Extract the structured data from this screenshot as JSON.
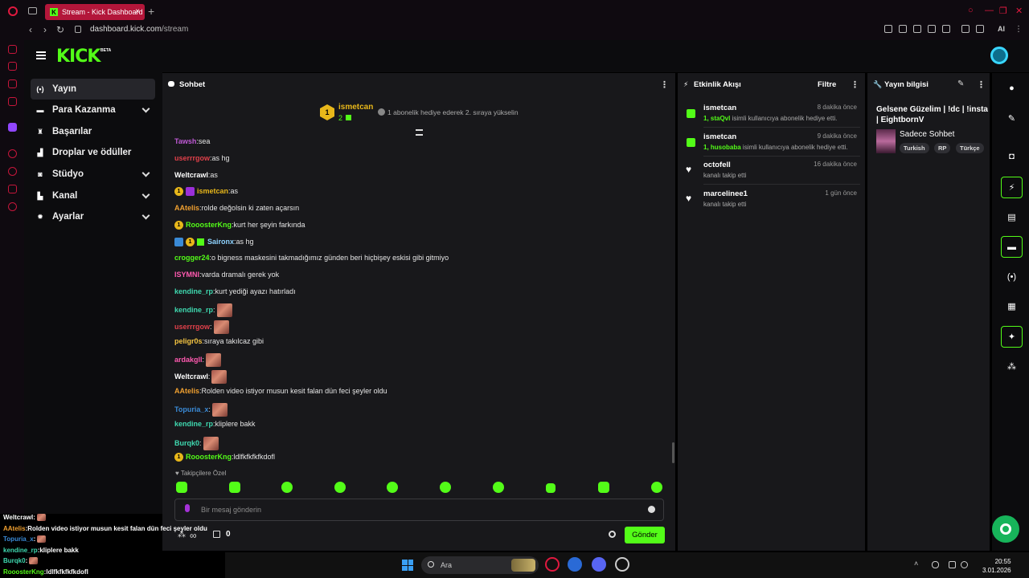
{
  "browser": {
    "tab_title": "Stream - Kick Dashboard",
    "url_host": "dashboard.kick.com",
    "url_path": "/stream",
    "ai_label": "AI"
  },
  "header": {
    "logo": "KICK",
    "beta": "BETA"
  },
  "nav": {
    "items": [
      {
        "label": "Yayın",
        "icon": "broadcast-icon",
        "active": true,
        "expandable": false
      },
      {
        "label": "Para Kazanma",
        "icon": "money-icon",
        "expandable": true
      },
      {
        "label": "Başarılar",
        "icon": "trophy-icon",
        "expandable": false
      },
      {
        "label": "Droplar ve ödüller",
        "icon": "drops-icon",
        "expandable": false
      },
      {
        "label": "Stüdyo",
        "icon": "studio-icon",
        "expandable": true
      },
      {
        "label": "Kanal",
        "icon": "channel-icon",
        "expandable": true
      },
      {
        "label": "Ayarlar",
        "icon": "gear-icon",
        "expandable": true
      }
    ]
  },
  "chat": {
    "title": "Sohbet",
    "pinned": {
      "user": "ismetcan",
      "badge": "1",
      "count": "2",
      "message": "1 abonelik hediye ederek 2. sıraya yükselin"
    },
    "messages": [
      {
        "user": "Tawsh",
        "color": "#c05ad6",
        "text": "sea"
      },
      {
        "user": "userrrgow",
        "color": "#e0404a",
        "text": "as hg"
      },
      {
        "user": "Weltcrawl",
        "color": "#ffffff",
        "text": "as"
      },
      {
        "user": "ismetcan",
        "color": "#e8b71a",
        "text": "as",
        "badges": [
          "sub",
          "purple"
        ]
      },
      {
        "user": "AAtelis",
        "color": "#f0a030",
        "text": "rolde değolsin ki zaten açarsın"
      },
      {
        "user": "RooosterKng",
        "color": "#53fc18",
        "text": "kurt her şeyin farkında",
        "badges": [
          "sub"
        ]
      },
      {
        "user": "Saironx",
        "color": "#8fd3ff",
        "text": "as hg",
        "badges": [
          "blue",
          "sub",
          "gift"
        ]
      },
      {
        "user": "crogger24",
        "color": "#53fc18",
        "text": "o bigness maskesini takmadığımız günden beri hiçbişey eskisi gibi gitmiyo"
      },
      {
        "user": "ISYMNI",
        "color": "#ff5ab0",
        "text": "varda dramalı gerek yok"
      },
      {
        "user": "kendine_rp",
        "color": "#3fd9b0",
        "text": "kurt yediği ayazı hatırladı"
      },
      {
        "user": "kendine_rp",
        "color": "#3fd9b0",
        "text": "",
        "emote": true
      },
      {
        "user": "userrrgow",
        "color": "#e0404a",
        "text": "",
        "emote": true
      },
      {
        "user": "peligr0s",
        "color": "#f5c542",
        "text": "sıraya takılcaz gibi"
      },
      {
        "user": "ardakgll",
        "color": "#ff5ab0",
        "text": "",
        "emote": true
      },
      {
        "user": "Weltcrawl",
        "color": "#ffffff",
        "text": "",
        "emote": true
      },
      {
        "user": "AAtelis",
        "color": "#f0a030",
        "text": "Rolden video istiyor musun kesit falan dün feci şeyler oldu"
      },
      {
        "user": "Topuria_x",
        "color": "#3a8ad6",
        "text": "",
        "emote": true
      },
      {
        "user": "kendine_rp",
        "color": "#3fd9b0",
        "text": "kliplere bakk"
      },
      {
        "user": "Burqk0",
        "color": "#3fd9b0",
        "text": "",
        "emote": true
      },
      {
        "user": "RooosterKng",
        "color": "#53fc18",
        "text": "ldlfkfkfkfkdofl",
        "badges": [
          "sub"
        ]
      }
    ],
    "followers_only": "Takipçilere Özel",
    "input_placeholder": "Bir mesaj gönderin",
    "points": "∞",
    "gift_count": "0",
    "send_label": "Gönder"
  },
  "activity": {
    "title": "Etkinlik Akışı",
    "filter_label": "Filtre",
    "items": [
      {
        "type": "gift",
        "user": "ismetcan",
        "time": "8 dakika önce",
        "target": "1, staQvl",
        "desc": "isimli kullanıcıya abonelik hediye etti."
      },
      {
        "type": "gift",
        "user": "ismetcan",
        "time": "9 dakika önce",
        "target": "1, husobaba",
        "desc": "isimli kullanıcıya abonelik hediye etti."
      },
      {
        "type": "follow",
        "user": "octofell",
        "time": "16 dakika önce",
        "target": "",
        "desc": "kanalı takip etti"
      },
      {
        "type": "follow",
        "user": "marcelinee1",
        "time": "1 gün önce",
        "target": "",
        "desc": "kanalı takip etti"
      }
    ]
  },
  "stream_info": {
    "title": "Yayın bilgisi",
    "stream_title": "Gelsene Güzelim | !dc | !insta | EightbornV",
    "category": "Sadece Sohbet",
    "tags": [
      "Turkish",
      "RP",
      "Türkçe"
    ]
  },
  "overlay_chat": [
    {
      "user": "Weltcrawl",
      "color": "#ffffff",
      "text": "",
      "emote": true
    },
    {
      "user": "AAtelis",
      "color": "#f0a030",
      "text": "Rolden video istiyor musun kesit falan dün feci şeyler oldu"
    },
    {
      "user": "Topuria_x",
      "color": "#3a8ad6",
      "text": "",
      "emote": true
    },
    {
      "user": "kendine_rp",
      "color": "#3fd9b0",
      "text": "kliplere bakk"
    },
    {
      "user": "Burqk0",
      "color": "#3fd9b0",
      "text": "",
      "emote": true
    },
    {
      "user": "RooosterKng",
      "color": "#53fc18",
      "text": "ldlfkfkfkfkdofl"
    }
  ],
  "taskbar": {
    "search_label": "Ara",
    "time": "20:55",
    "date": "3.01.2026"
  }
}
